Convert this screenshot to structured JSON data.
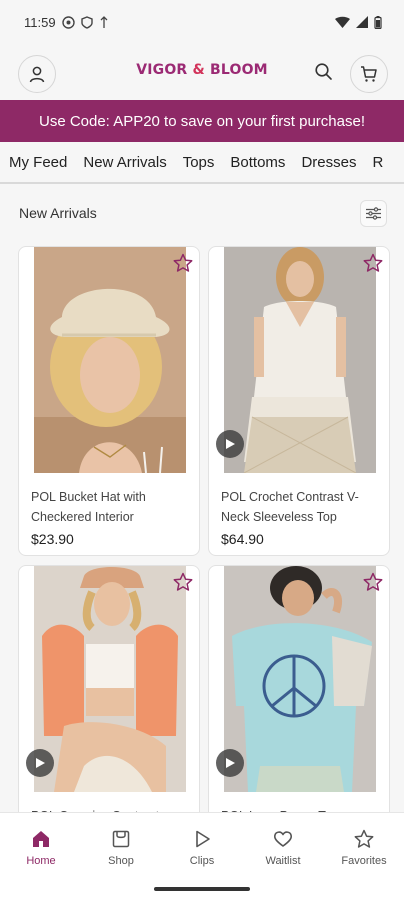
{
  "status": {
    "time": "11:59"
  },
  "header": {
    "brand_part1": "VIGOR ",
    "brand_amp": "&",
    "brand_part2": " BLOOM"
  },
  "promo": {
    "text": "Use Code: APP20 to save on your first purchase!"
  },
  "tabs": [
    {
      "label": "My Feed",
      "active": false
    },
    {
      "label": "New Arrivals",
      "active": true
    },
    {
      "label": "Tops",
      "active": false
    },
    {
      "label": "Bottoms",
      "active": false
    },
    {
      "label": "Dresses",
      "active": false
    },
    {
      "label": "R",
      "active": false
    }
  ],
  "section": {
    "title": "New Arrivals"
  },
  "products": [
    {
      "name": "POL Bucket Hat with Checkered Interior",
      "price": "$23.90",
      "has_video": false
    },
    {
      "name": "POL Crochet Contrast V-Neck Sleeveless Top",
      "price": "$64.90",
      "has_video": true
    },
    {
      "name": "POL Oversize Contrast",
      "price": "",
      "has_video": true
    },
    {
      "name": "POL Lace Peace Top",
      "price": "",
      "has_video": true
    }
  ],
  "bottom_nav": [
    {
      "label": "Home",
      "icon": "home-icon",
      "active": true
    },
    {
      "label": "Shop",
      "icon": "shop-icon",
      "active": false
    },
    {
      "label": "Clips",
      "icon": "play-icon",
      "active": false
    },
    {
      "label": "Waitlist",
      "icon": "heart-icon",
      "active": false
    },
    {
      "label": "Favorites",
      "icon": "star-icon",
      "active": false
    }
  ],
  "colors": {
    "accent": "#8e2966",
    "brand": "#9b2a74",
    "brand_amp": "#d2335a"
  }
}
